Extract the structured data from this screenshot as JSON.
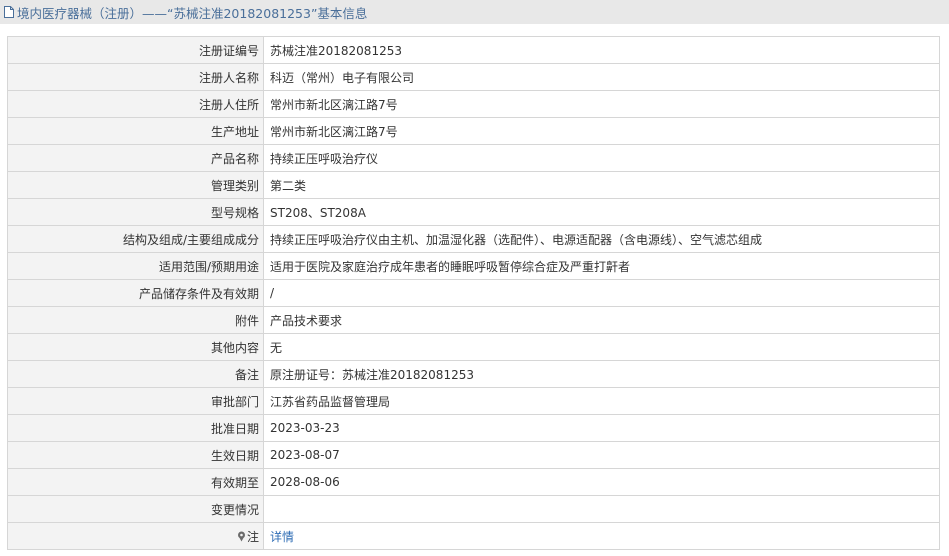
{
  "header": {
    "title": "境内医疗器械（注册）——“苏械注准20182081253”基本信息",
    "icon": "document-icon"
  },
  "rows": [
    {
      "label": "注册证编号",
      "value": "苏械注准20182081253"
    },
    {
      "label": "注册人名称",
      "value": "科迈（常州）电子有限公司"
    },
    {
      "label": "注册人住所",
      "value": "常州市新北区漓江路7号"
    },
    {
      "label": "生产地址",
      "value": "常州市新北区漓江路7号"
    },
    {
      "label": "产品名称",
      "value": "持续正压呼吸治疗仪"
    },
    {
      "label": "管理类别",
      "value": "第二类"
    },
    {
      "label": "型号规格",
      "value": "ST208、ST208A"
    },
    {
      "label": "结构及组成/主要组成成分",
      "value": "持续正压呼吸治疗仪由主机、加温湿化器（选配件）、电源适配器（含电源线）、空气滤芯组成"
    },
    {
      "label": "适用范围/预期用途",
      "value": "适用于医院及家庭治疗成年患者的睡眠呼吸暂停综合症及严重打鼾者"
    },
    {
      "label": "产品储存条件及有效期",
      "value": "/"
    },
    {
      "label": "附件",
      "value": "产品技术要求"
    },
    {
      "label": "其他内容",
      "value": "无"
    },
    {
      "label": "备注",
      "value": "原注册证号：苏械注准20182081253"
    },
    {
      "label": "审批部门",
      "value": "江苏省药品监督管理局"
    },
    {
      "label": "批准日期",
      "value": "2023-03-23"
    },
    {
      "label": "生效日期",
      "value": "2023-08-07"
    },
    {
      "label": "有效期至",
      "value": "2028-08-06"
    },
    {
      "label": "变更情况",
      "value": ""
    }
  ],
  "note_row": {
    "label": "注",
    "icon": "pin-icon",
    "link": "详情"
  },
  "colors": {
    "header_bg": "#e8e8e8",
    "title_text": "#4a6f9a",
    "label_bg": "#f3f3f3",
    "border": "#d6d6d6",
    "link": "#2f6db5"
  }
}
